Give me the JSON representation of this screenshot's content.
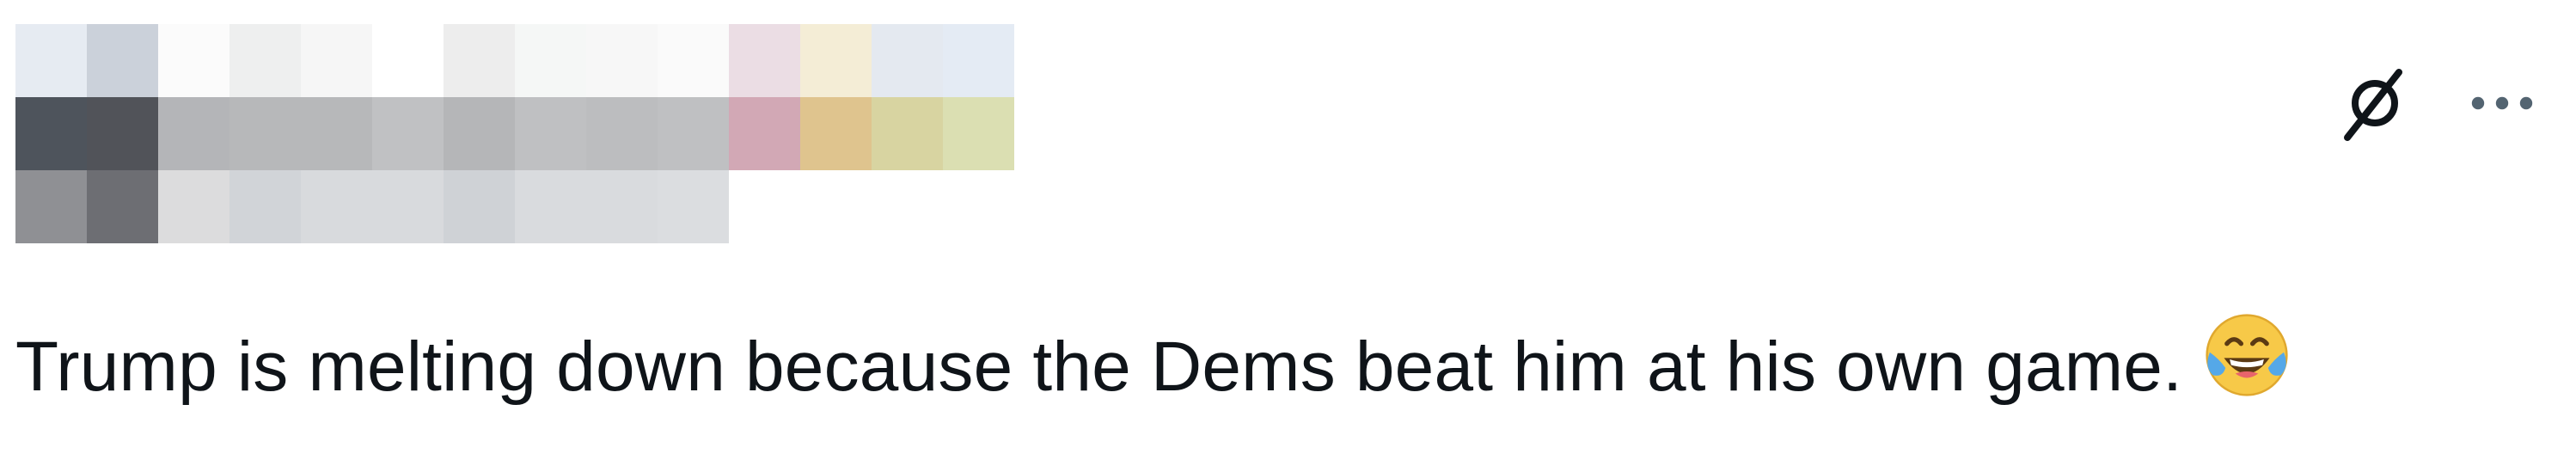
{
  "header": {
    "author_block": "redacted-pixelated",
    "pixel_rows": [
      [
        "#e6ebf2",
        "#cbd1da",
        "#fbfbfb",
        "#eeefef",
        "#f6f6f6",
        "#ffffff",
        "#ededed",
        "#f5f7f6",
        "#f7f7f7",
        "#fafafa",
        "#ebdde4",
        "#f4edd6",
        "#e4e9f0",
        "#e4ebf4"
      ],
      [
        "#4e545c",
        "#515359",
        "#b4b5b8",
        "#b7b8ba",
        "#b7b8ba",
        "#c0c1c3",
        "#b5b6b8",
        "#bfc0c2",
        "#bcbdbf",
        "#bfc0c2",
        "#d2a8b5",
        "#dfc48e",
        "#d8d4a1",
        "#dbdfb2"
      ],
      [
        "#8f9094",
        "#6d6e73",
        "#dcdcdd",
        "#d1d4d8",
        "#d8dadd",
        "#d8dadd",
        "#cfd2d6",
        "#d9dbde",
        "#d9dbde",
        "#dbdde0",
        "#ffffff",
        "#ffffff",
        "#ffffff",
        "#ffffff"
      ]
    ]
  },
  "actions": {
    "grok_icon": "grok-slash-icon",
    "more_icon": "more-dots-icon"
  },
  "tweet": {
    "text": "Trump is melting down because the Dems beat him at his own game.",
    "emoji": "face-with-tears-of-joy"
  },
  "colors": {
    "text": "#0f1419",
    "icon": "#0f1419",
    "background": "#ffffff"
  }
}
